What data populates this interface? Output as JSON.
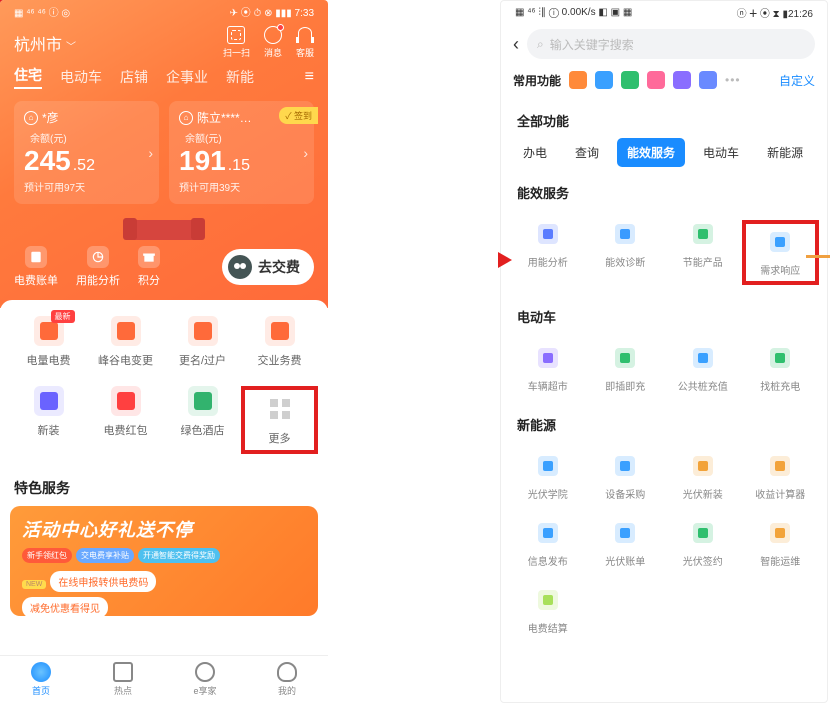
{
  "left": {
    "status": {
      "left_icons": "▦ ⁴⁶ ⁴⁶ ⓘ ◎",
      "right": "✈ ⦿ ⏱ ⊗ ▮▮▮ 7:33"
    },
    "location": "杭州市",
    "top": {
      "scan": "扫一扫",
      "msg": "消息",
      "cs": "客服"
    },
    "tabs": [
      "住宅",
      "电动车",
      "店铺",
      "企事业",
      "新能"
    ],
    "cards": [
      {
        "owner": "*彦",
        "bal_label": "余额(元)",
        "int": "245",
        "dec": ".52",
        "days": "预计可用97天"
      },
      {
        "owner": "陈立****…",
        "bal_label": "余额(元)",
        "int": "191",
        "dec": ".15",
        "days": "预计可用39天",
        "sign": "签到"
      }
    ],
    "mini": [
      "电费账单",
      "用能分析",
      "积分"
    ],
    "pay": "去交费",
    "grid": [
      {
        "label": "电量电费",
        "badge": "最新",
        "color": "#ff6a3a"
      },
      {
        "label": "峰谷电变更",
        "color": "#ff6a3a"
      },
      {
        "label": "更名/过户",
        "color": "#ff6a3a"
      },
      {
        "label": "交业务费",
        "color": "#ff6a3a"
      },
      {
        "label": "新装",
        "color": "#6a63ff"
      },
      {
        "label": "电费红包",
        "color": "#ff4040"
      },
      {
        "label": "绿色酒店",
        "color": "#32b36e"
      },
      {
        "label": "更多",
        "color": "#cfcfcf",
        "more": true
      }
    ],
    "special": "特色服务",
    "banner": {
      "title": "活动中心好礼送不停",
      "tags": [
        "新手领红包",
        "交电费享补贴",
        "开通智能交费得奖励"
      ],
      "line1": "在线申报转供电费码",
      "line2": "减免优惠看得见",
      "new": "NEW"
    },
    "nav": [
      "首页",
      "热点",
      "e享家",
      "我的"
    ]
  },
  "right": {
    "status": {
      "left": "▦ ⁴⁶ ⫶∥ ⓘ 0.00K/s ◧ ▣ ▦",
      "right": "ⓝ ⵜ ⦿ ⧗ ▮21:26"
    },
    "search_placeholder": "输入关键字搜索",
    "common": "常用功能",
    "customize": "自定义",
    "all": "全部功能",
    "tabs": [
      "办电",
      "查询",
      "能效服务",
      "电动车",
      "新能源"
    ],
    "sections": [
      {
        "title": "能效服务",
        "items": [
          {
            "label": "用能分析",
            "c": "#5a7cff"
          },
          {
            "label": "能效诊断",
            "c": "#3a9bff"
          },
          {
            "label": "节能产品",
            "c": "#2fbf6e"
          },
          {
            "label": "需求响应",
            "c": "#3aa0ff",
            "hi": true
          }
        ]
      },
      {
        "title": "电动车",
        "items": [
          {
            "label": "车辆超市",
            "c": "#8a6dff"
          },
          {
            "label": "即插即充",
            "c": "#2fbf6e"
          },
          {
            "label": "公共桩充值",
            "c": "#3aa0ff"
          },
          {
            "label": "找桩充电",
            "c": "#2fbf6e"
          }
        ]
      },
      {
        "title": "新能源",
        "items": [
          {
            "label": "光伏学院",
            "c": "#3aa0ff"
          },
          {
            "label": "设备采购",
            "c": "#3aa0ff"
          },
          {
            "label": "光伏新装",
            "c": "#f2a33a"
          },
          {
            "label": "收益计算器",
            "c": "#f2a33a"
          },
          {
            "label": "信息发布",
            "c": "#3aa0ff"
          },
          {
            "label": "光伏账单",
            "c": "#3aa0ff"
          },
          {
            "label": "光伏签约",
            "c": "#2fbf6e"
          },
          {
            "label": "智能运维",
            "c": "#f2a33a"
          },
          {
            "label": "电费结算",
            "c": "#a8e05a"
          }
        ]
      }
    ]
  }
}
